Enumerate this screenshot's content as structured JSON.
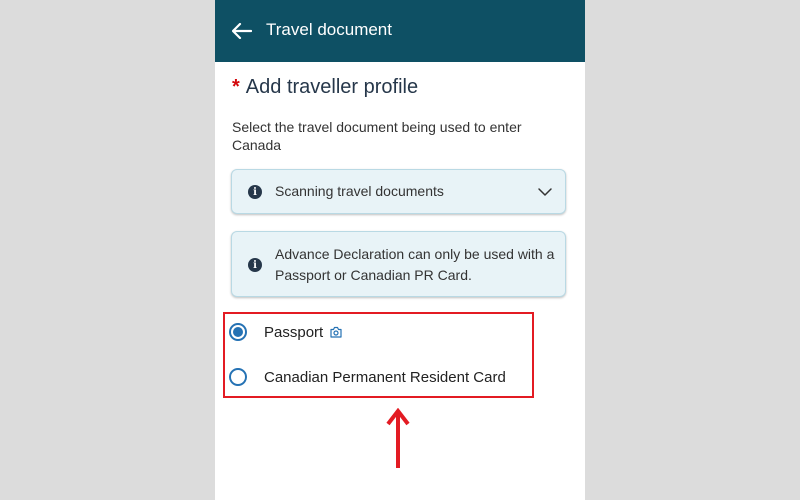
{
  "header": {
    "back_icon": "arrow-left-icon",
    "title": "Travel document",
    "color": "#0e5064"
  },
  "main": {
    "required_marker": "*",
    "heading": "Add traveller profile",
    "description": "Select the travel document being used to enter Canada",
    "accordion": {
      "icon": "info-icon",
      "label": "Scanning travel documents",
      "expanded": false
    },
    "notice": {
      "icon": "info-icon",
      "text": "Advance Declaration can only be used with a Passport or Canadian PR Card."
    },
    "radio_options": [
      {
        "label": "Passport",
        "selected": true,
        "icon": "camera-icon"
      },
      {
        "label": "Canadian Permanent Resident Card",
        "selected": false
      }
    ]
  },
  "annotation": {
    "highlight_color": "#e31b23",
    "arrow_icon": "arrow-up-icon"
  }
}
